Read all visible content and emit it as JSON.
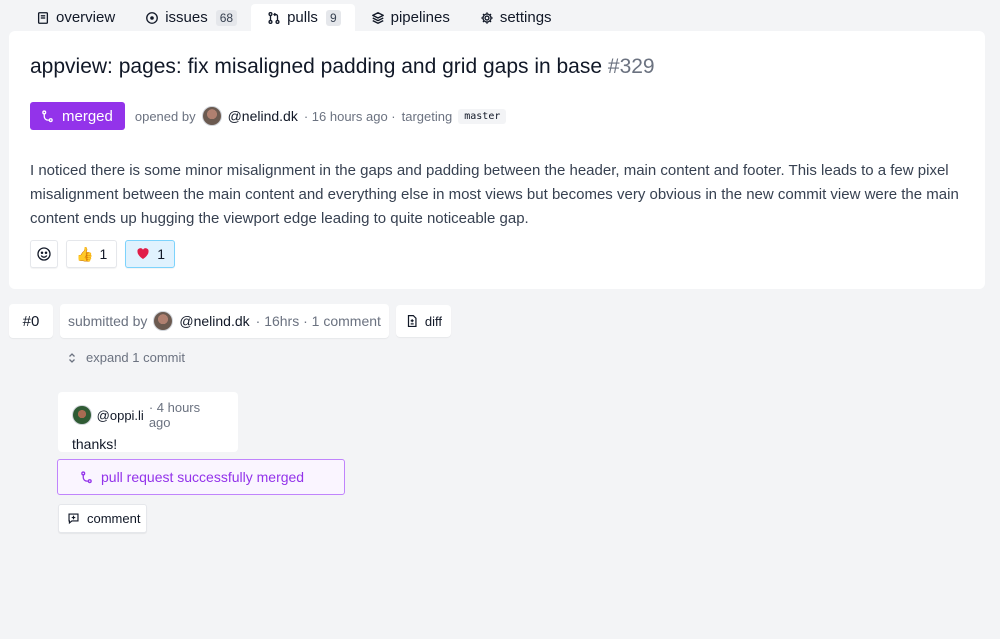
{
  "tabs": [
    {
      "label": "overview",
      "icon": "book-icon"
    },
    {
      "label": "issues",
      "count": "68",
      "icon": "circle-dot-icon"
    },
    {
      "label": "pulls",
      "count": "9",
      "icon": "git-pull-request-icon"
    },
    {
      "label": "pipelines",
      "icon": "layers-icon"
    },
    {
      "label": "settings",
      "icon": "gear-icon"
    }
  ],
  "pull": {
    "title": "appview: pages: fix misaligned padding and grid gaps in base",
    "number": "#329",
    "status": "merged",
    "opened_by_prefix": "opened by",
    "author": "@nelind.dk",
    "time_ago": "· 16 hours ago ·",
    "targeting": "targeting",
    "branch": "master",
    "body": "I noticed there is some minor misalignment in the gaps and padding between the header, main content and footer. This leads to a few pixel misalignment between the main content and everything else in most views but becomes very obvious in the new commit view were the main content ends up hugging the viewport edge leading to quite noticeable gap.",
    "reactions": [
      {
        "emoji": "👍",
        "count": "1",
        "active": false
      },
      {
        "emoji": "❤️",
        "count": "1",
        "active": true
      }
    ]
  },
  "round": {
    "number": "#0",
    "submitted_by": "submitted by",
    "author": "@nelind.dk",
    "meta": "· 16hrs · 1 comment",
    "diff_label": "diff",
    "expand_label": "expand 1 commit"
  },
  "comment": {
    "author": "@oppi.li",
    "time": "· 4 hours ago",
    "text": "thanks!"
  },
  "merged_message": "pull request successfully merged",
  "comment_button": "comment",
  "colors": {
    "merged": "#9333ea",
    "background": "#f3f4f6",
    "card": "#ffffff"
  }
}
